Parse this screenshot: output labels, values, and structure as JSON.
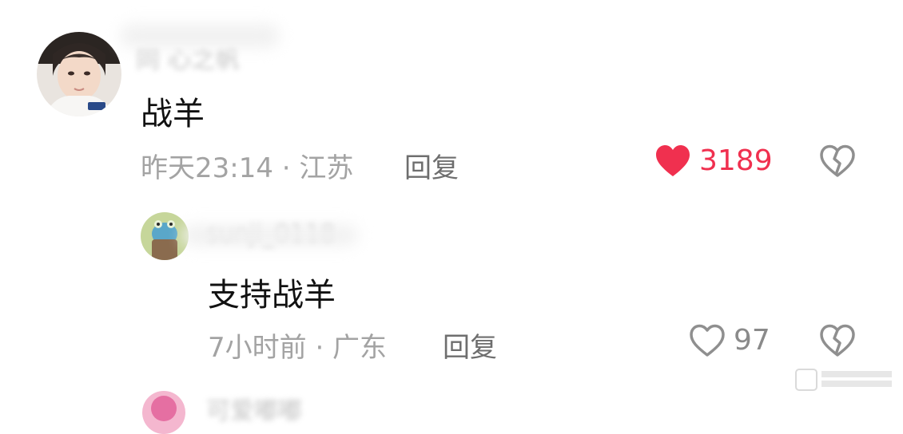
{
  "comments": [
    {
      "username": "同 心之帆",
      "content": "战羊",
      "meta": "昨天23:14 · 江苏",
      "reply_label": "回复",
      "likes": "3189",
      "liked": true,
      "like_color": "#f0304f"
    }
  ],
  "replies": [
    {
      "username": "sunji_0118",
      "content": "支持战羊",
      "meta": "7小时前 · 广东",
      "reply_label": "回复",
      "likes": "97",
      "liked": false
    }
  ],
  "next_comment": {
    "username": "可爱嘟嘟"
  }
}
